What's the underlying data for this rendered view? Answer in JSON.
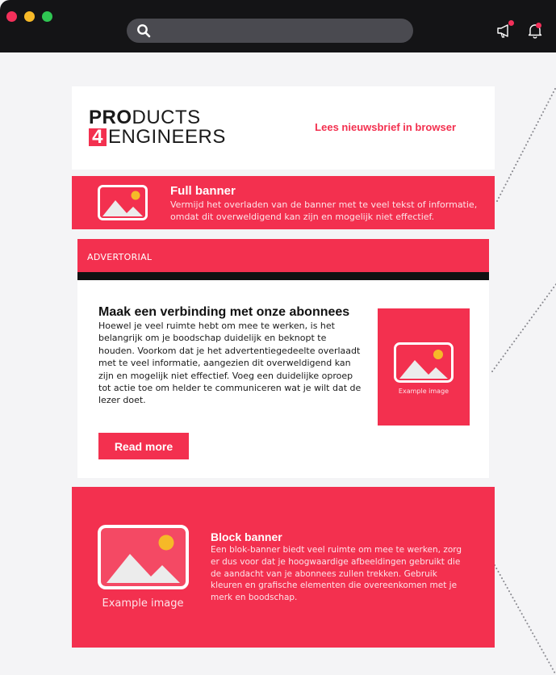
{
  "window": {
    "controls": [
      "close",
      "minimize",
      "maximize"
    ],
    "icons": {
      "search": "search-icon",
      "megaphone": "megaphone-icon",
      "bell": "bell-icon"
    },
    "accent": "#f3304f"
  },
  "newsletter": {
    "logo": {
      "line1_bold": "PRO",
      "line1_thin": "DUCTS",
      "line2_number": "4",
      "line2_thin": "ENGINEERS"
    },
    "view_in_browser": "Lees nieuwsbrief in browser",
    "full_banner": {
      "title": "Full banner",
      "description": "Vermijd het overladen van de banner met te veel tekst of informatie, omdat dit overweldigend kan zijn en mogelijk niet effectief."
    },
    "advertorial": {
      "label": "ADVERTORIAL",
      "title": "Maak een verbinding met onze abonnees",
      "body": "Hoewel je veel ruimte hebt om mee te werken, is het belangrijk om je boodschap duidelijk en beknopt te houden. Voorkom dat je het advertentiegedeelte overlaadt met te veel informatie, aangezien dit overweldigend kan zijn en mogelijk niet effectief. Voeg een duidelijke oproep tot actie toe om helder te communiceren wat je wilt dat de lezer doet.",
      "image_caption": "Example image",
      "button_label": "Read more"
    },
    "block_banner": {
      "title": "Block banner",
      "description": "Een blok-banner biedt veel ruimte om mee te werken, zorg er dus voor dat je hoogwaardige afbeeldingen gebruikt die de aandacht van je abonnees zullen trekken. Gebruik kleuren en grafische elementen die overeenkomen met je merk en boodschap.",
      "image_caption": "Example image"
    }
  }
}
